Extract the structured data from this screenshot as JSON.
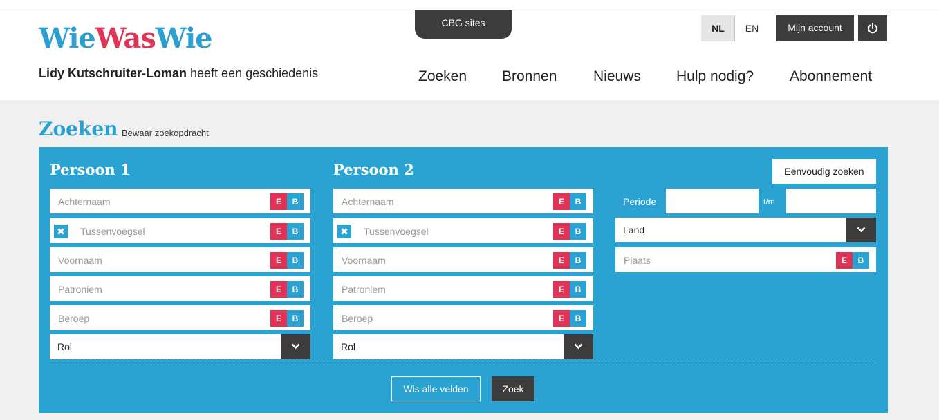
{
  "header": {
    "cbg_tab": "CBG sites",
    "logo": {
      "part1": "Wie",
      "part2": "Was",
      "part3": "Wie"
    },
    "tagline": {
      "name": "Lidy Kutschruiter-Loman",
      "rest": " heeft een geschiedenis"
    },
    "lang_nl": "NL",
    "lang_en": "EN",
    "account": "Mijn account",
    "power_icon": "power-icon",
    "nav": [
      "Zoeken",
      "Bronnen",
      "Nieuws",
      "Hulp nodig?",
      "Abonnement"
    ]
  },
  "search": {
    "title": "Zoeken",
    "save_link": "Bewaar zoekopdracht",
    "simple_search": "Eenvoudig zoeken",
    "persons": [
      {
        "title": "Persoon 1",
        "fields": [
          "Achternaam",
          "Tussenvoegsel",
          "Voornaam",
          "Patroniem",
          "Beroep"
        ],
        "role": "Rol"
      },
      {
        "title": "Persoon 2",
        "fields": [
          "Achternaam",
          "Tussenvoegsel",
          "Voornaam",
          "Patroniem",
          "Beroep"
        ],
        "role": "Rol"
      }
    ],
    "eb": {
      "e": "E",
      "b": "B"
    },
    "checkbox_mark": "✖",
    "periode_label": "Periode",
    "tm_label": "t/m",
    "land": "Land",
    "plaats": "Plaats",
    "clear_button": "Wis alle velden",
    "search_button": "Zoek"
  },
  "colors": {
    "accent_blue": "#2aa3d3",
    "accent_red": "#e03355",
    "dark": "#3c3c3c"
  }
}
